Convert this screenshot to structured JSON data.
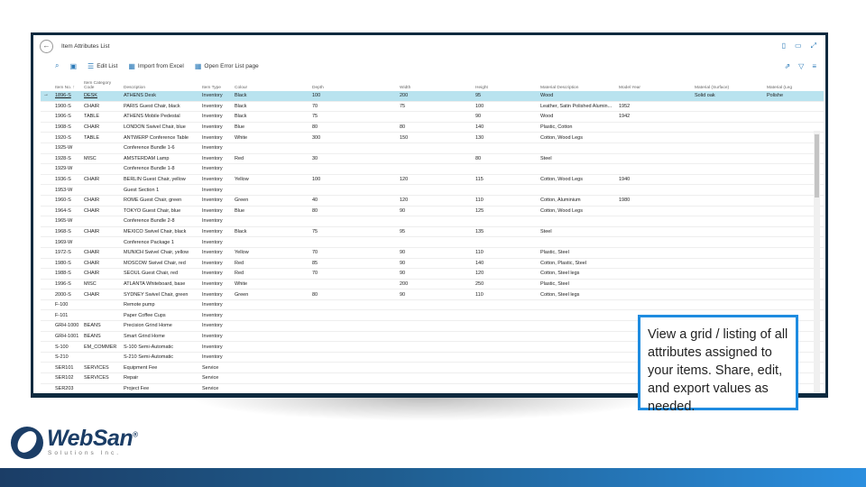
{
  "window": {
    "title": "Item Attributes List"
  },
  "actions": {
    "edit_list": "Edit List",
    "import_excel": "Import from Excel",
    "open_error": "Open Error List page"
  },
  "columns": [
    "Item No. ↑",
    "Item Category Code",
    "Description",
    "Item Type",
    "Colour",
    "Depth",
    "Width",
    "Height",
    "Material Description",
    "Model Year",
    "Material (Surface)",
    "Material (Leg"
  ],
  "rows": [
    {
      "item": "1896-S",
      "cat": "DESK",
      "desc": "ATHENS Desk",
      "type": "Inventory",
      "colour": "Black",
      "depth": "100",
      "width": "200",
      "height": "95",
      "material": "Wood",
      "year": "",
      "surface": "Solid oak",
      "leg": "Polishe"
    },
    {
      "item": "1900-S",
      "cat": "CHAIR",
      "desc": "PARIS Guest Chair, black",
      "type": "Inventory",
      "colour": "Black",
      "depth": "70",
      "width": "75",
      "height": "100",
      "material": "Leather, Satin Polished Alumin...",
      "year": "1952",
      "surface": "",
      "leg": ""
    },
    {
      "item": "1906-S",
      "cat": "TABLE",
      "desc": "ATHENS Mobile Pedestal",
      "type": "Inventory",
      "colour": "Black",
      "depth": "75",
      "width": "",
      "height": "90",
      "material": "Wood",
      "year": "1942",
      "surface": "",
      "leg": ""
    },
    {
      "item": "1908-S",
      "cat": "CHAIR",
      "desc": "LONDON Swivel Chair, blue",
      "type": "Inventory",
      "colour": "Blue",
      "depth": "80",
      "width": "80",
      "height": "140",
      "material": "Plastic, Cotton",
      "year": "",
      "surface": "",
      "leg": ""
    },
    {
      "item": "1920-S",
      "cat": "TABLE",
      "desc": "ANTWERP Conference Table",
      "type": "Inventory",
      "colour": "White",
      "depth": "300",
      "width": "150",
      "height": "130",
      "material": "Cotton, Wood Legs",
      "year": "",
      "surface": "",
      "leg": ""
    },
    {
      "item": "1925-W",
      "cat": "",
      "desc": "Conference Bundle 1-6",
      "type": "Inventory",
      "colour": "",
      "depth": "",
      "width": "",
      "height": "",
      "material": "",
      "year": "",
      "surface": "",
      "leg": ""
    },
    {
      "item": "1928-S",
      "cat": "MISC",
      "desc": "AMSTERDAM Lamp",
      "type": "Inventory",
      "colour": "Red",
      "depth": "30",
      "width": "",
      "height": "80",
      "material": "Steel",
      "year": "",
      "surface": "",
      "leg": ""
    },
    {
      "item": "1929-W",
      "cat": "",
      "desc": "Conference Bundle 1-8",
      "type": "Inventory",
      "colour": "",
      "depth": "",
      "width": "",
      "height": "",
      "material": "",
      "year": "",
      "surface": "",
      "leg": ""
    },
    {
      "item": "1936-S",
      "cat": "CHAIR",
      "desc": "BERLIN Guest Chair, yellow",
      "type": "Inventory",
      "colour": "Yellow",
      "depth": "100",
      "width": "120",
      "height": "115",
      "material": "Cotton, Wood Legs",
      "year": "1940",
      "surface": "",
      "leg": ""
    },
    {
      "item": "1953-W",
      "cat": "",
      "desc": "Guest Section 1",
      "type": "Inventory",
      "colour": "",
      "depth": "",
      "width": "",
      "height": "",
      "material": "",
      "year": "",
      "surface": "",
      "leg": ""
    },
    {
      "item": "1960-S",
      "cat": "CHAIR",
      "desc": "ROME Guest Chair, green",
      "type": "Inventory",
      "colour": "Green",
      "depth": "40",
      "width": "120",
      "height": "110",
      "material": "Cotton, Aluminium",
      "year": "1980",
      "surface": "",
      "leg": ""
    },
    {
      "item": "1964-S",
      "cat": "CHAIR",
      "desc": "TOKYO Guest Chair, blue",
      "type": "Inventory",
      "colour": "Blue",
      "depth": "80",
      "width": "90",
      "height": "125",
      "material": "Cotton, Wood Legs",
      "year": "",
      "surface": "",
      "leg": ""
    },
    {
      "item": "1965-W",
      "cat": "",
      "desc": "Conference Bundle 2-8",
      "type": "Inventory",
      "colour": "",
      "depth": "",
      "width": "",
      "height": "",
      "material": "",
      "year": "",
      "surface": "",
      "leg": ""
    },
    {
      "item": "1968-S",
      "cat": "CHAIR",
      "desc": "MEXICO Swivel Chair, black",
      "type": "Inventory",
      "colour": "Black",
      "depth": "75",
      "width": "95",
      "height": "135",
      "material": "Steel",
      "year": "",
      "surface": "",
      "leg": ""
    },
    {
      "item": "1969-W",
      "cat": "",
      "desc": "Conference Package 1",
      "type": "Inventory",
      "colour": "",
      "depth": "",
      "width": "",
      "height": "",
      "material": "",
      "year": "",
      "surface": "",
      "leg": ""
    },
    {
      "item": "1972-S",
      "cat": "CHAIR",
      "desc": "MUNICH Swivel Chair, yellow",
      "type": "Inventory",
      "colour": "Yellow",
      "depth": "70",
      "width": "90",
      "height": "110",
      "material": "Plastic, Steel",
      "year": "",
      "surface": "",
      "leg": ""
    },
    {
      "item": "1980-S",
      "cat": "CHAIR",
      "desc": "MOSCOW Swivel Chair, red",
      "type": "Inventory",
      "colour": "Red",
      "depth": "85",
      "width": "90",
      "height": "140",
      "material": "Cotton, Plastic, Steel",
      "year": "",
      "surface": "",
      "leg": ""
    },
    {
      "item": "1988-S",
      "cat": "CHAIR",
      "desc": "SEOUL Guest Chair, red",
      "type": "Inventory",
      "colour": "Red",
      "depth": "70",
      "width": "90",
      "height": "120",
      "material": "Cotton, Steel legs",
      "year": "",
      "surface": "",
      "leg": ""
    },
    {
      "item": "1996-S",
      "cat": "MISC",
      "desc": "ATLANTA Whiteboard, base",
      "type": "Inventory",
      "colour": "White",
      "depth": "",
      "width": "200",
      "height": "250",
      "material": "Plastic, Steel",
      "year": "",
      "surface": "",
      "leg": ""
    },
    {
      "item": "2000-S",
      "cat": "CHAIR",
      "desc": "SYDNEY Swivel Chair, green",
      "type": "Inventory",
      "colour": "Green",
      "depth": "80",
      "width": "90",
      "height": "110",
      "material": "Cotton, Steel legs",
      "year": "",
      "surface": "",
      "leg": ""
    },
    {
      "item": "F-100",
      "cat": "",
      "desc": "Remote pump",
      "type": "Inventory",
      "colour": "",
      "depth": "",
      "width": "",
      "height": "",
      "material": "",
      "year": "",
      "surface": "",
      "leg": ""
    },
    {
      "item": "F-101",
      "cat": "",
      "desc": "Paper Coffee Cups",
      "type": "Inventory",
      "colour": "",
      "depth": "",
      "width": "",
      "height": "",
      "material": "",
      "year": "",
      "surface": "",
      "leg": ""
    },
    {
      "item": "GRH-1000",
      "cat": "BEANS",
      "desc": "Precision Grind Home",
      "type": "Inventory",
      "colour": "",
      "depth": "",
      "width": "",
      "height": "",
      "material": "",
      "year": "",
      "surface": "",
      "leg": ""
    },
    {
      "item": "GRH-1001",
      "cat": "BEANS",
      "desc": "Smart Grind Home",
      "type": "Inventory",
      "colour": "",
      "depth": "",
      "width": "",
      "height": "",
      "material": "",
      "year": "",
      "surface": "",
      "leg": ""
    },
    {
      "item": "S-100",
      "cat": "EM_COMMER",
      "desc": "S-100 Semi-Automatic",
      "type": "Inventory",
      "colour": "",
      "depth": "",
      "width": "",
      "height": "",
      "material": "",
      "year": "",
      "surface": "",
      "leg": ""
    },
    {
      "item": "S-210",
      "cat": "",
      "desc": "S-210 Semi-Automatic",
      "type": "Inventory",
      "colour": "",
      "depth": "",
      "width": "",
      "height": "",
      "material": "",
      "year": "",
      "surface": "",
      "leg": ""
    },
    {
      "item": "SER101",
      "cat": "SERVICES",
      "desc": "Equipment Fee",
      "type": "Service",
      "colour": "",
      "depth": "",
      "width": "",
      "height": "",
      "material": "",
      "year": "",
      "surface": "",
      "leg": ""
    },
    {
      "item": "SER102",
      "cat": "SERVICES",
      "desc": "Repair",
      "type": "Service",
      "colour": "",
      "depth": "",
      "width": "",
      "height": "",
      "material": "",
      "year": "",
      "surface": "",
      "leg": ""
    },
    {
      "item": "SER203",
      "cat": "",
      "desc": "Project Fee",
      "type": "Service",
      "colour": "",
      "depth": "",
      "width": "",
      "height": "",
      "material": "",
      "year": "",
      "surface": "",
      "leg": ""
    }
  ],
  "callout": {
    "text": "View a grid / listing of all attributes assigned to your items. Share, edit, and export values as needed."
  },
  "logo": {
    "name": "WebSan",
    "sub": "Solutions Inc.",
    "reg": "®"
  },
  "colors": {
    "accent": "#1f8ce0",
    "selected_row": "#b9e3ef",
    "brand": "#1b3d66"
  }
}
